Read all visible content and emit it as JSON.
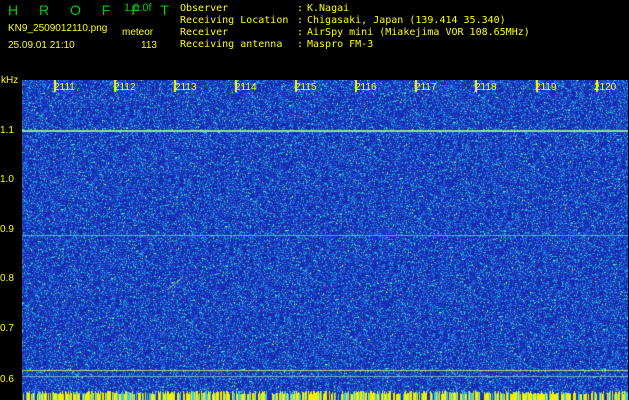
{
  "header": {
    "logo": "H R O F F T",
    "version": "1.0.0f",
    "filename": "KN9_2509012110.png",
    "mode": "meteor",
    "datetime": "25.09.01 21:10",
    "count": "113"
  },
  "info": [
    {
      "label": "Observer",
      "value": "K.Nagai"
    },
    {
      "label": "Receiving Location",
      "value": "Chigasaki, Japan (139.414 35.340)"
    },
    {
      "label": "Receiver",
      "value": "AirSpy mini (Miakejima VOR 108.65MHz)"
    },
    {
      "label": "Receiving antenna",
      "value": "Maspro FM-3"
    }
  ],
  "axis": {
    "y_unit": "kHz",
    "y_ticks": [
      "1.1",
      "1.0",
      "0.9",
      "0.8",
      "0.7",
      "0.6"
    ],
    "x_ticks": [
      "2111",
      "2112",
      "2113",
      "2114",
      "2115",
      "2116",
      "2117",
      "2118",
      "2119",
      "2120"
    ]
  },
  "colors": {
    "background": "#000000",
    "plot_bg": "#1a2fb0",
    "text": "#ffff00",
    "logo": "#00d000"
  }
}
